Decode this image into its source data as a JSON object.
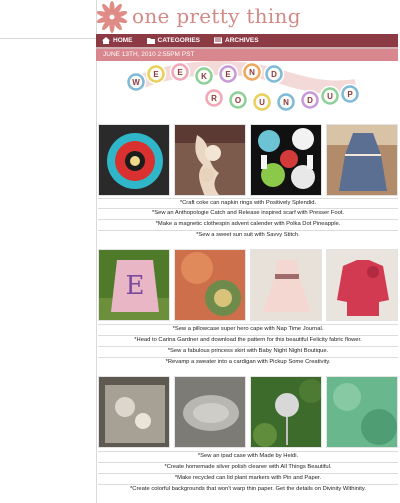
{
  "site": {
    "title": "one pretty thing"
  },
  "nav": {
    "items": [
      {
        "label": "HOME",
        "icon": "home-icon"
      },
      {
        "label": "CATEGORIES",
        "icon": "folder-icon"
      },
      {
        "label": "ARCHIVES",
        "icon": "archive-icon"
      }
    ]
  },
  "post": {
    "date": "JUNE 13TH, 2010 2:55PM PST",
    "banner_letters": [
      "W",
      "E",
      "E",
      "K",
      "E",
      "N",
      "D",
      "R",
      "O",
      "U",
      "N",
      "D",
      "U",
      "P"
    ]
  },
  "captions": {
    "group1": [
      "*Craft coke can napkin rings with Positively Splendid.",
      "*Sew an Anthopologie Catch and Release inspired scarf with Presser Foot.",
      "*Make a magnetic clothespin advent calender with Polka Dot Pineapple.",
      "*Sew a sweet sun suit with Savvy Stitch."
    ],
    "group2": [
      "*Sew a pillowcase super hero cape with Nap Time Journal.",
      "*Head to Carina Gardner and download the pattern for this beautiful Felicity fabric flower.",
      "*Sew a fabulous princess skirt with Baby Night Night Boutique.",
      "*Revamp a sweater into a cardigan with Pickup Some Creativity."
    ],
    "group3": [
      "*Sew an ipad case with Made by Heidi.",
      "*Create homemade silver polish cleaner with All Things Beautiful.",
      "*Make recycled can lid plant markers with Pin and Paper.",
      "*Create colorful backgrounds that won't warp thin paper.  Get the details on Divinity Withinity."
    ]
  },
  "colors": {
    "nav_bg": "#8c3b45",
    "date_bg": "#d7878d",
    "title": "#d18a86"
  }
}
